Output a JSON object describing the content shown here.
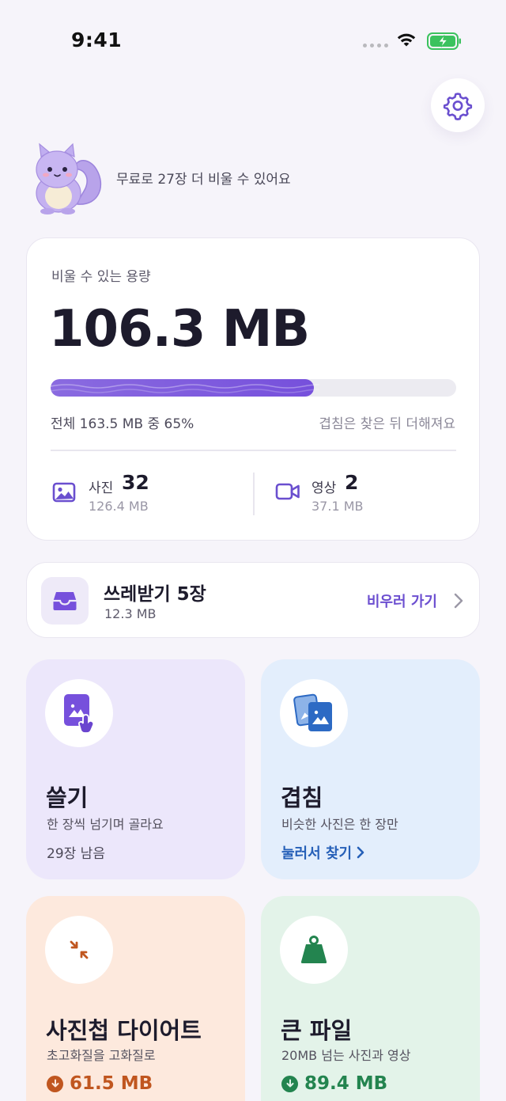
{
  "status_bar": {
    "time": "9:41"
  },
  "mascot": {
    "message": "무료로 27장 더 비울 수 있어요"
  },
  "capacity": {
    "label": "비울 수 있는 용량",
    "value": "106.3 MB",
    "progress_percent": 65,
    "summary": "전체 163.5 MB 중 65%",
    "note": "겹침은 찾은 뒤 더해져요",
    "photo": {
      "name": "사진",
      "count": "32",
      "size": "126.4 MB"
    },
    "video": {
      "name": "영상",
      "count": "2",
      "size": "37.1 MB"
    }
  },
  "trash": {
    "title": "쓰레받기 5장",
    "size": "12.3 MB",
    "action": "비우러 가기"
  },
  "tiles": {
    "swipe": {
      "title": "쓸기",
      "desc": "한 장씩 넘기며 골라요",
      "meta": "29장 남음"
    },
    "duplicates": {
      "title": "겹침",
      "desc": "비슷한 사진은 한 장만",
      "link": "눌러서 찾기"
    },
    "diet": {
      "title": "사진첩 다이어트",
      "desc": "초고화질을 고화질로",
      "amount": "61.5 MB"
    },
    "large_files": {
      "title": "큰 파일",
      "desc": "20MB 넘는 사진과 영상",
      "amount": "89.4 MB"
    }
  },
  "colors": {
    "accent_purple": "#7650dc",
    "link_blue": "#2660b8",
    "orange": "#c0561f",
    "green": "#23844f",
    "background": "#f6f4fa"
  }
}
